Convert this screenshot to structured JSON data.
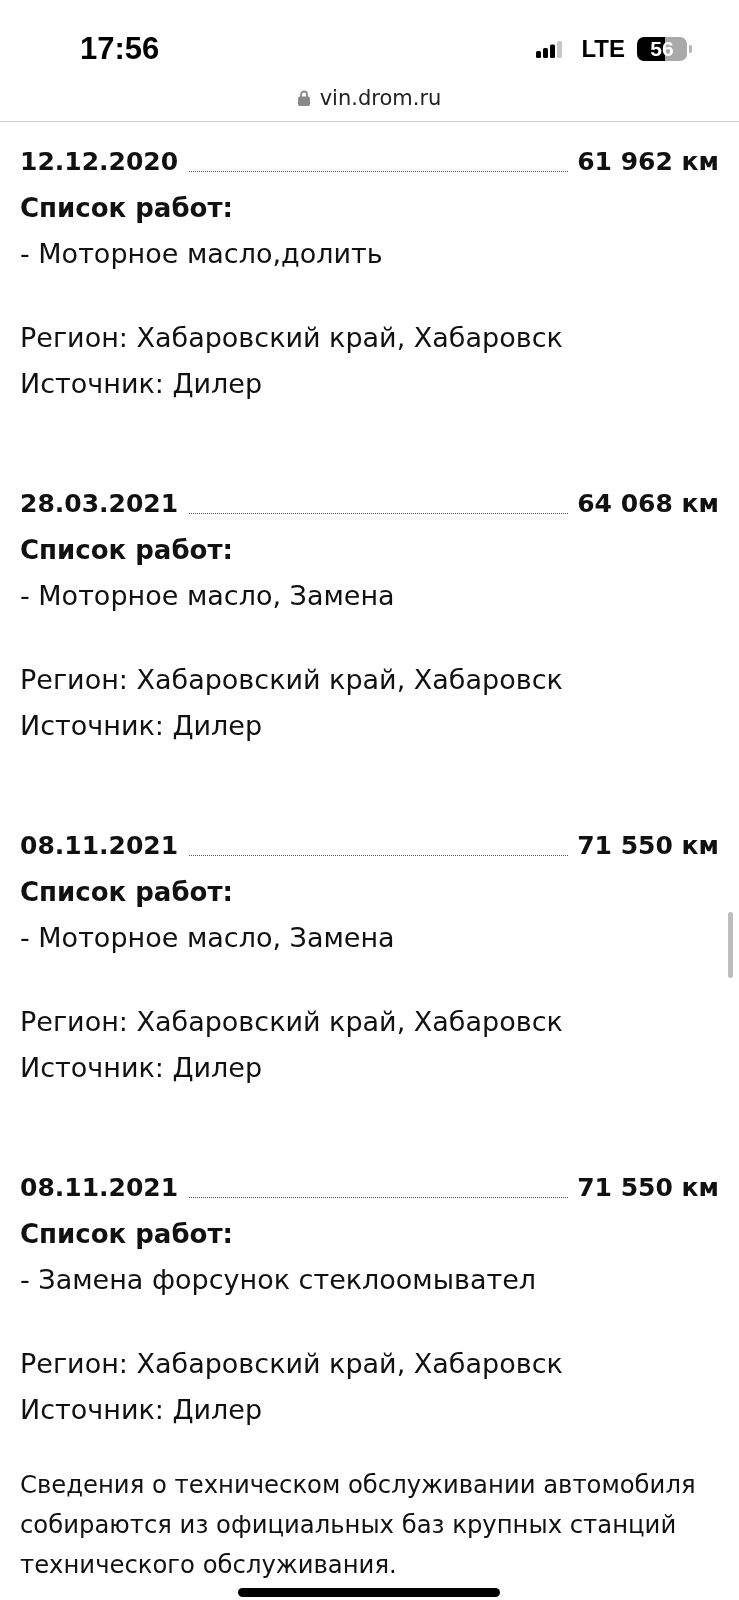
{
  "status_bar": {
    "time": "17:56",
    "network": "LTE",
    "battery": "56"
  },
  "address_bar": {
    "url": "vin.drom.ru"
  },
  "records": [
    {
      "date": "12.12.2020",
      "mileage": "61 962 км",
      "works_title": "Список работ:",
      "works": [
        "- Моторное масло,долить"
      ],
      "region": "Регион: Хабаровский край, Хабаровск",
      "source": "Источник: Дилер"
    },
    {
      "date": "28.03.2021",
      "mileage": "64 068 км",
      "works_title": "Список работ:",
      "works": [
        "- Моторное масло, Замена"
      ],
      "region": "Регион: Хабаровский край, Хабаровск",
      "source": "Источник: Дилер"
    },
    {
      "date": "08.11.2021",
      "mileage": "71 550 км",
      "works_title": "Список работ:",
      "works": [
        "- Моторное масло, Замена"
      ],
      "region": "Регион: Хабаровский край, Хабаровск",
      "source": "Источник: Дилер"
    },
    {
      "date": "08.11.2021",
      "mileage": "71 550 км",
      "works_title": "Список работ:",
      "works": [
        "- Замена форсунок стеклоомывател"
      ],
      "region": "Регион: Хабаровский край, Хабаровск",
      "source": "Источник: Дилер"
    }
  ],
  "disclaimer": "Сведения о техническом обслуживании автомобиля собираются из официальных баз крупных станций технического обслуживания."
}
